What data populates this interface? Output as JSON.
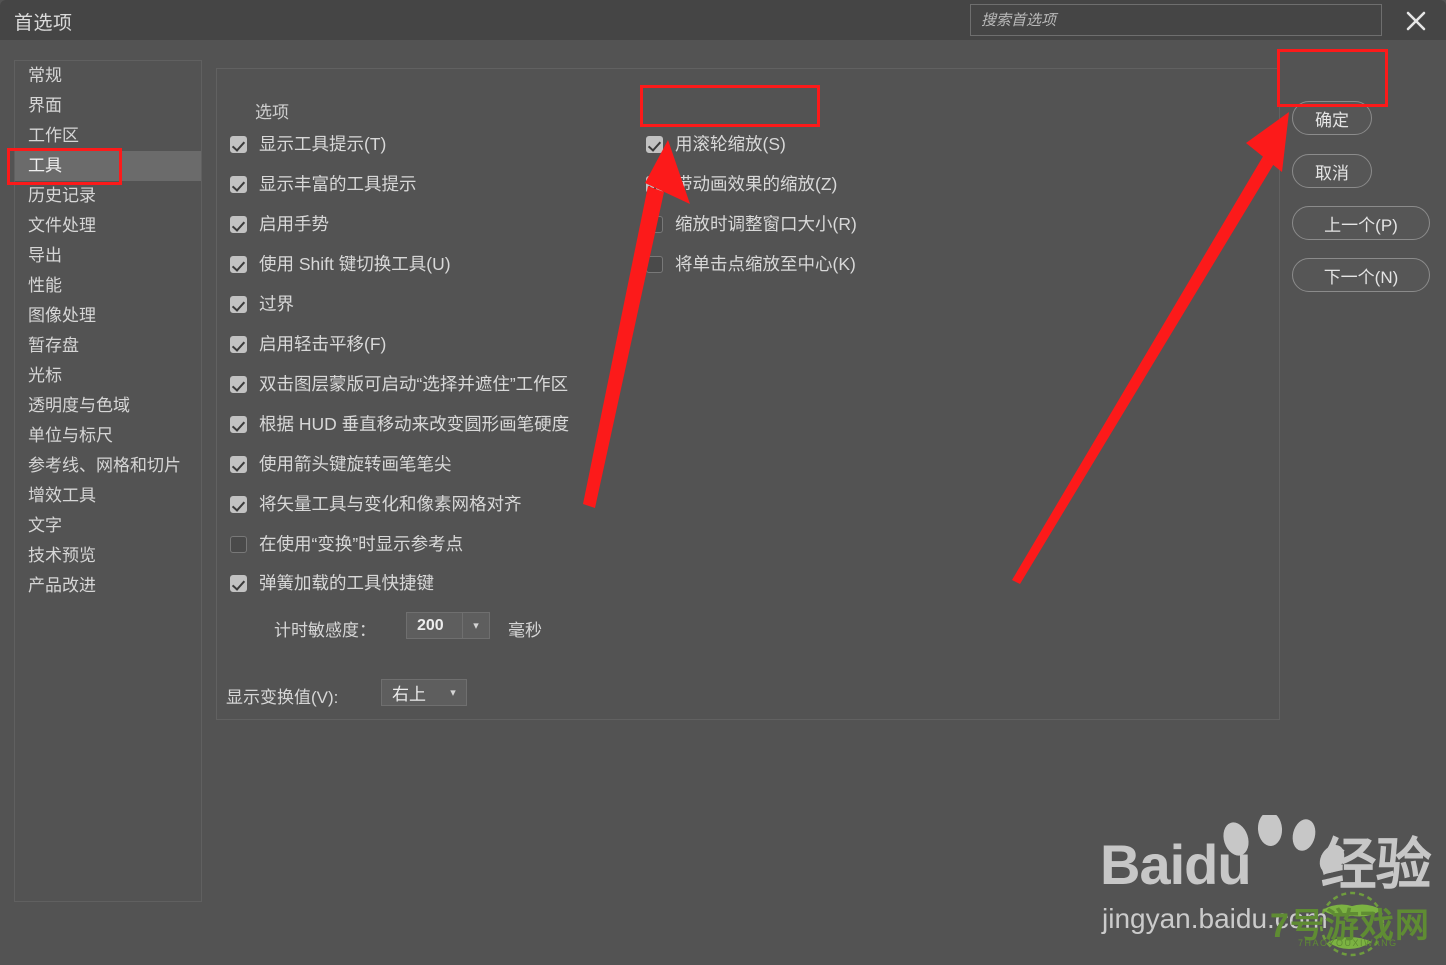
{
  "window": {
    "title": "首选项",
    "close_icon": "close-icon"
  },
  "search": {
    "placeholder": "搜索首选项",
    "value": "",
    "icon": "search-field"
  },
  "sidebar": {
    "items": [
      {
        "label": "常规",
        "selected": false
      },
      {
        "label": "界面",
        "selected": false
      },
      {
        "label": "工作区",
        "selected": false
      },
      {
        "label": "工具",
        "selected": true
      },
      {
        "label": "历史记录",
        "selected": false
      },
      {
        "label": "文件处理",
        "selected": false
      },
      {
        "label": "导出",
        "selected": false
      },
      {
        "label": "性能",
        "selected": false
      },
      {
        "label": "图像处理",
        "selected": false
      },
      {
        "label": "暂存盘",
        "selected": false
      },
      {
        "label": "光标",
        "selected": false
      },
      {
        "label": "透明度与色域",
        "selected": false
      },
      {
        "label": "单位与标尺",
        "selected": false
      },
      {
        "label": "参考线、网格和切片",
        "selected": false
      },
      {
        "label": "增效工具",
        "selected": false
      },
      {
        "label": "文字",
        "selected": false
      },
      {
        "label": "技术预览",
        "selected": false
      },
      {
        "label": "产品改进",
        "selected": false
      }
    ]
  },
  "options_group": {
    "legend": "选项",
    "left_column": [
      {
        "label": "显示工具提示(T)",
        "checked": true
      },
      {
        "label": "显示丰富的工具提示",
        "checked": true
      },
      {
        "label": "启用手势",
        "checked": true
      },
      {
        "label": "使用 Shift 键切换工具(U)",
        "checked": true
      },
      {
        "label": "过界",
        "checked": true
      },
      {
        "label": "启用轻击平移(F)",
        "checked": true
      },
      {
        "label": "双击图层蒙版可启动“选择并遮住”工作区",
        "checked": true
      },
      {
        "label": "根据 HUD 垂直移动来改变圆形画笔硬度",
        "checked": true
      },
      {
        "label": "使用箭头键旋转画笔笔尖",
        "checked": true
      },
      {
        "label": "将矢量工具与变化和像素网格对齐",
        "checked": true
      },
      {
        "label": "在使用“变换”时显示参考点",
        "checked": false
      },
      {
        "label": "弹簧加载的工具快捷键",
        "checked": true
      }
    ],
    "right_column": [
      {
        "label": "用滚轮缩放(S)",
        "checked": true
      },
      {
        "label": "带动画效果的缩放(Z)",
        "checked": true
      },
      {
        "label": "缩放时调整窗口大小(R)",
        "checked": false
      },
      {
        "label": "将单击点缩放至中心(K)",
        "checked": false
      }
    ],
    "sensitivity": {
      "label": "计时敏感度：",
      "value": "200",
      "unit": "毫秒",
      "arrow": "chevron-down-icon"
    },
    "transform_values": {
      "label": "显示变换值(V):",
      "value": "右上",
      "arrow": "chevron-down-icon"
    }
  },
  "buttons": {
    "ok": "确定",
    "cancel": "取消",
    "prev": "上一个(P)",
    "next": "下一个(N)"
  },
  "annotations": {
    "highlight_color": "#fc1a1a",
    "boxes": [
      "工具",
      "用滚轮缩放(S)",
      "确定"
    ],
    "arrow_count": 2
  },
  "watermarks": {
    "baidu_brand": "Baidu",
    "baidu_suffix": "经验",
    "baidu_url": "jingyan.baidu.com",
    "game_site": "7号游戏网",
    "game_site_pinyin": "7HAOYOUXIWANG"
  },
  "colors": {
    "window_bg": "#535353",
    "titlebar_bg": "#454545",
    "selection_bg": "#6b6b6b",
    "accent_red": "#fc1a1a",
    "text": "#d8d8d8"
  }
}
